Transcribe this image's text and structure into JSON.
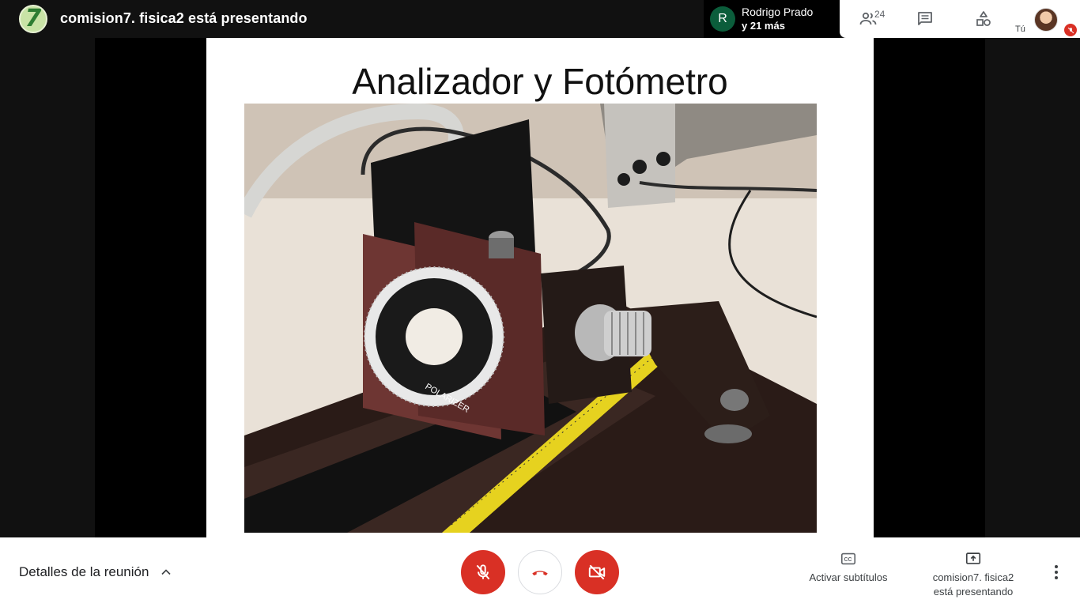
{
  "topbar": {
    "presenter_avatar_glyph": "7",
    "presenting_title": "comision7. fisica2 está presentando",
    "participant_initial": "R",
    "participant_name": "Rodrigo Prado",
    "participant_more": "y 21 más",
    "people_count": "24",
    "self_label": "Tú",
    "icons": [
      "people-icon",
      "chat-icon",
      "activities-icon",
      "mic-off-icon"
    ]
  },
  "slide": {
    "title": "Analizador y Fotómetro",
    "dial_label": "POLARIZER"
  },
  "bottombar": {
    "details_label": "Detalles de la reunión",
    "captions_label": "Activar subtítulos",
    "presenting_line1": "comision7. fisica2",
    "presenting_line2": "está presentando",
    "colors": {
      "danger": "#d93025",
      "text": "#3c4043"
    }
  }
}
